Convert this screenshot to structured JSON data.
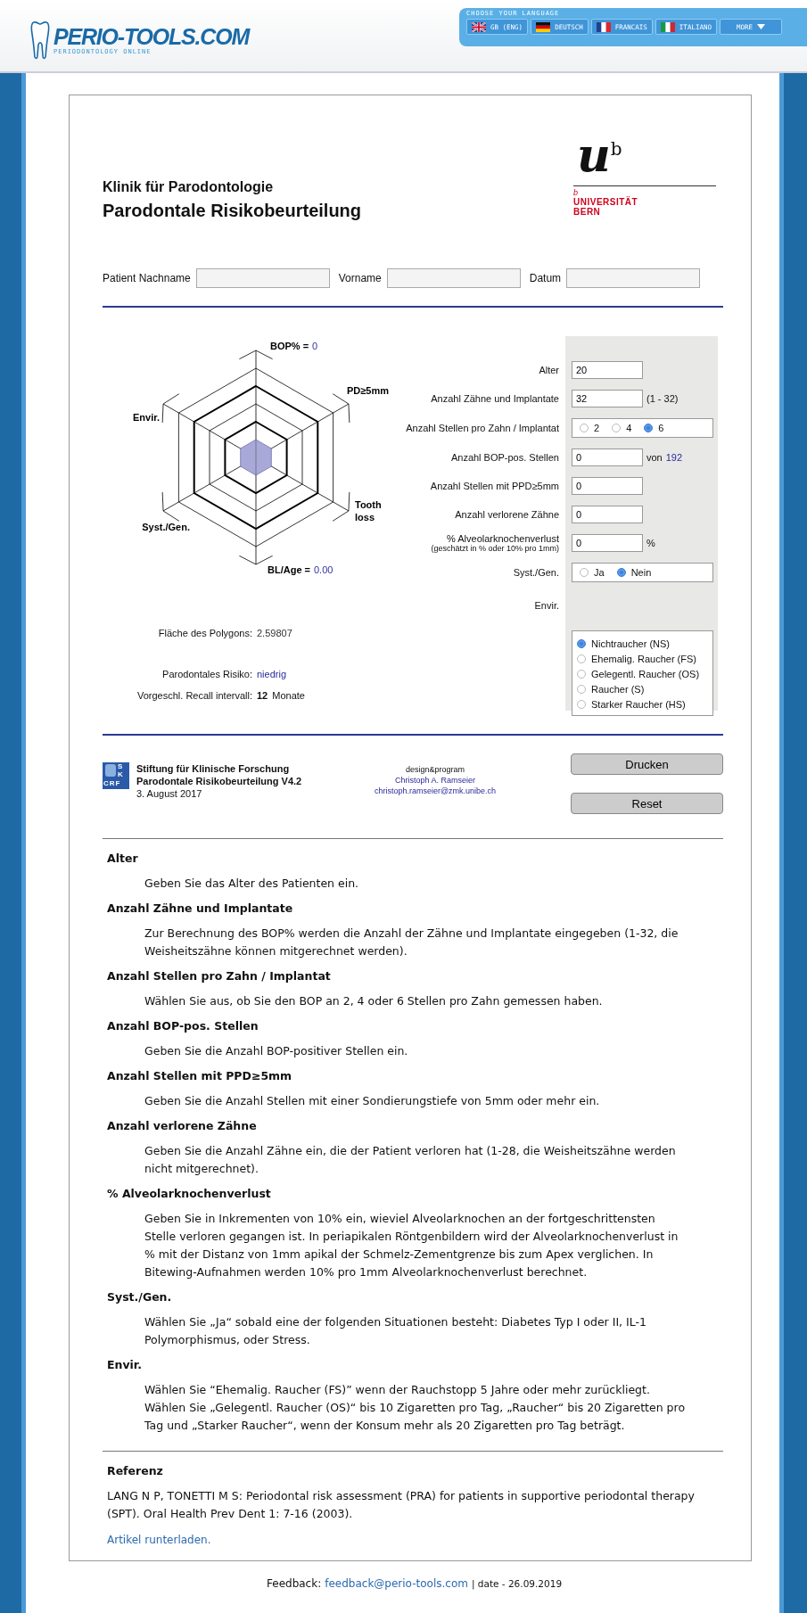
{
  "header": {
    "logo_title": "PERIO-TOOLS.COM",
    "logo_subtitle": "PERIODONTOLOGY ONLINE",
    "language_caption": "CHOOSE YOUR LANGUAGE",
    "languages": [
      {
        "label": "GB (ENG)",
        "kind": "gb"
      },
      {
        "label": "DEUTSCH",
        "kind": "de"
      },
      {
        "label": "FRANCAIS",
        "kind": "fr"
      },
      {
        "label": "ITALIANO",
        "kind": "it"
      }
    ],
    "more": "MORE"
  },
  "form_header": {
    "clinic": "Klinik für Parodontologie",
    "title": "Parodontale Risikobeurteilung",
    "university": {
      "mark": "u",
      "mark_sup": "b",
      "small_b": "b",
      "line1": "UNIVERSITÄT",
      "line2": "BERN"
    }
  },
  "patient_fields": [
    {
      "label": "Patient Nachname"
    },
    {
      "label": "Vorname"
    },
    {
      "label": "Datum"
    }
  ],
  "radar": {
    "axis_labels": [
      {
        "lines": [
          "BOP% ="
        ],
        "value": "0"
      },
      {
        "lines": [
          "PD≥5mm"
        ]
      },
      {
        "lines": [
          "Tooth",
          "loss"
        ]
      },
      {
        "lines": [
          "BL/Age ="
        ],
        "value": "0.00"
      },
      {
        "lines": [
          "Syst./Gen."
        ]
      },
      {
        "lines": [
          "Envir."
        ]
      }
    ]
  },
  "results": [
    {
      "kind": "plain",
      "label": "Fläche des Polygons:",
      "value": "2.59807"
    },
    {
      "kind": "risk",
      "label": "Parodontales Risiko:",
      "value": "niedrig"
    },
    {
      "kind": "recall",
      "label": "Vorgeschl. Recall intervall:",
      "value": "12",
      "unit": "Monate"
    }
  ],
  "inputs": [
    {
      "kind": "text",
      "label": "Alter",
      "value": "20"
    },
    {
      "kind": "text",
      "label": "Anzahl Zähne und Implantate",
      "value": "32",
      "suffix": "(1 - 32)"
    },
    {
      "kind": "radio",
      "label": "Anzahl Stellen pro Zahn / Implantat",
      "options": [
        {
          "label": "2",
          "selected": false
        },
        {
          "label": "4",
          "selected": false
        },
        {
          "label": "6",
          "selected": true
        }
      ]
    },
    {
      "kind": "text",
      "label": "Anzahl BOP-pos. Stellen",
      "value": "0",
      "suffix": "von",
      "suffix_value": "192"
    },
    {
      "kind": "text",
      "label": "Anzahl Stellen mit PPD≥5mm",
      "value": "0"
    },
    {
      "kind": "text",
      "label": "Anzahl verlorene Zähne",
      "value": "0"
    },
    {
      "kind": "text",
      "label": "% Alveolarknochenverlust",
      "note": "(geschätzt in % oder 10% pro 1mm)",
      "value": "0",
      "suffix": "%"
    },
    {
      "kind": "radio",
      "label": "Syst./Gen.",
      "options": [
        {
          "label": "Ja",
          "selected": false
        },
        {
          "label": "Nein",
          "selected": true
        }
      ]
    },
    {
      "kind": "radio_list",
      "label": "Envir.",
      "options": [
        {
          "label": "Nichtraucher (NS)",
          "selected": true
        },
        {
          "label": "Ehemalig. Raucher (FS)",
          "selected": false
        },
        {
          "label": "Gelegentl. Raucher (OS)",
          "selected": false
        },
        {
          "label": "Raucher (S)",
          "selected": false
        },
        {
          "label": "Starker Raucher (HS)",
          "selected": false
        }
      ]
    }
  ],
  "footer": {
    "logo_side": [
      "S",
      "K"
    ],
    "logo_bottom": "CRF",
    "org": "Stiftung für Klinische Forschung",
    "product": "Parodontale Risikobeurteilung V4.2",
    "date": "3. August 2017",
    "credit_label": "design&program",
    "author": "Christoph A. Ramseier",
    "email": "christoph.ramseier@zmk.unibe.ch",
    "buttons": [
      "Drucken",
      "Reset"
    ]
  },
  "help": [
    {
      "heading": "Alter",
      "paragraphs": [
        "Geben Sie das Alter des Patienten ein."
      ]
    },
    {
      "heading": "Anzahl Zähne und Implantate",
      "paragraphs": [
        "Zur Berechnung des BOP% werden die Anzahl der Zähne und Implantate eingegeben (1-32, die Weisheitszähne können mitgerechnet werden)."
      ]
    },
    {
      "heading": "Anzahl Stellen pro Zahn / Implantat",
      "paragraphs": [
        "Wählen Sie aus, ob Sie den BOP an 2, 4 oder 6 Stellen pro Zahn gemessen haben."
      ]
    },
    {
      "heading": "Anzahl BOP-pos. Stellen",
      "paragraphs": [
        "Geben Sie die Anzahl BOP-positiver Stellen ein."
      ]
    },
    {
      "heading": "Anzahl Stellen mit PPD≥5mm",
      "paragraphs": [
        "Geben Sie die Anzahl Stellen mit einer Sondierungstiefe von 5mm oder mehr ein."
      ]
    },
    {
      "heading": "Anzahl verlorene Zähne",
      "paragraphs": [
        "Geben Sie die Anzahl Zähne ein, die der Patient verloren hat (1-28, die Weisheitszähne werden nicht mitgerechnet)."
      ]
    },
    {
      "heading": "% Alveolarknochenverlust",
      "paragraphs": [
        "Geben Sie in Inkrementen von 10% ein, wieviel Alveolarknochen an der fortgeschrittensten Stelle verloren gegangen ist.  In periapikalen Röntgenbildern wird der Alveolarknochenverlust in % mit der Distanz von 1mm apikal der Schmelz-Zementgrenze bis zum Apex verglichen.  In Bitewing-Aufnahmen werden 10% pro 1mm Alveolarknochenverlust berechnet."
      ]
    },
    {
      "heading": "Syst./Gen.",
      "paragraphs": [
        "Wählen Sie „Ja“ sobald eine der folgenden Situationen besteht: Diabetes Typ I oder II, IL-1 Polymorphismus, oder Stress."
      ]
    },
    {
      "heading": "Envir.",
      "paragraphs": [
        "Wählen Sie “Ehemalig. Raucher (FS)” wenn der Rauchstopp 5 Jahre oder mehr zurückliegt.",
        "Wählen Sie „Gelegentl. Raucher (OS)“ bis 10 Zigaretten pro Tag, „Raucher“ bis 20 Zigaretten pro Tag und „Starker Raucher“, wenn der Konsum mehr als 20 Zigaretten pro Tag beträgt."
      ]
    }
  ],
  "reference": {
    "heading": "Referenz",
    "text": "LANG N P, TONETTI M S: Periodontal risk assessment (PRA) for patients in supportive periodontal therapy (SPT). Oral Health Prev Dent 1: 7-16 (2003).",
    "link": "Artikel runterladen."
  },
  "feedback": {
    "label": "Feedback:",
    "email": "feedback@perio-tools.com",
    "date": "| date - 26.09.2019"
  }
}
